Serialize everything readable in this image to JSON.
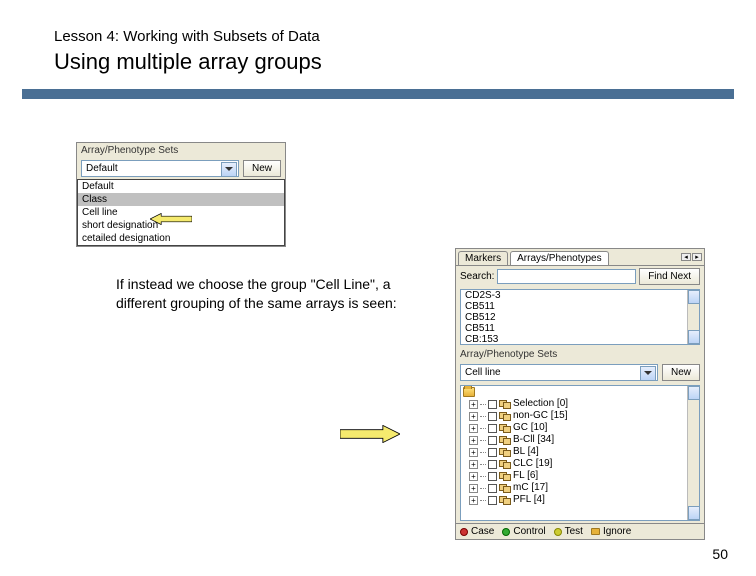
{
  "header": {
    "lesson": "Lesson 4: Working with Subsets of Data",
    "title": "Using multiple array groups"
  },
  "left_panel": {
    "title": "Array/Phenotype Sets",
    "selected": "Default",
    "new_btn": "New",
    "options": [
      "Default",
      "Class",
      "Cell line",
      "short designation",
      "cetailed designation"
    ]
  },
  "body_text": "If instead we choose the group \"Cell Line\", a different grouping of the same arrays is seen:",
  "right_panel": {
    "tabs": [
      "Markers",
      "Arrays/Phenotypes"
    ],
    "search_label": "Search:",
    "find_next": "Find Next",
    "list_items": [
      "CD2S-3",
      "CB511",
      "CB512",
      "CB511",
      "CB:153"
    ],
    "sets_title": "Array/Phenotype Sets",
    "sets_selected": "Cell line",
    "new_btn": "New",
    "tree": [
      {
        "label": "Selection [0]"
      },
      {
        "label": "non-GC [15]"
      },
      {
        "label": "GC [10]"
      },
      {
        "label": "B-Cll [34]"
      },
      {
        "label": "BL [4]"
      },
      {
        "label": "CLC [19]"
      },
      {
        "label": "FL [6]"
      },
      {
        "label": "mC [17]"
      },
      {
        "label": "PFL [4]"
      }
    ],
    "status": [
      {
        "label": "Case",
        "color_class": "red"
      },
      {
        "label": "Control",
        "color_class": "green"
      },
      {
        "label": "Test",
        "color_class": "yellow"
      },
      {
        "label": "Ignore",
        "color_class": "folder"
      }
    ]
  },
  "page_number": "50"
}
